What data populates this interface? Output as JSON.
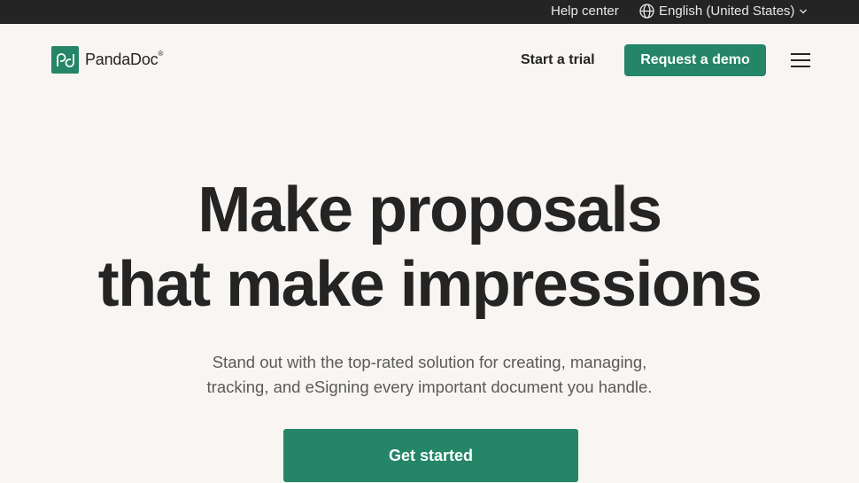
{
  "topbar": {
    "help_label": "Help center",
    "language_label": "English (United States)",
    "globe_icon": "globe-icon",
    "chevron_icon": "chevron-down-icon"
  },
  "header": {
    "logo_text": "PandaDoc",
    "logo_mark": "pd",
    "trial_label": "Start a trial",
    "demo_label": "Request a demo",
    "menu_icon": "hamburger-menu-icon"
  },
  "hero": {
    "title_line1": "Make proposals",
    "title_line2": "that make impressions",
    "subtitle_line1": "Stand out with the top-rated solution for creating, managing,",
    "subtitle_line2": "tracking, and eSigning every important document you handle.",
    "cta_label": "Get started"
  },
  "colors": {
    "brand_green": "#248567",
    "topbar_bg": "#242424",
    "page_bg": "#f8f5f2",
    "text_dark": "#242424"
  }
}
